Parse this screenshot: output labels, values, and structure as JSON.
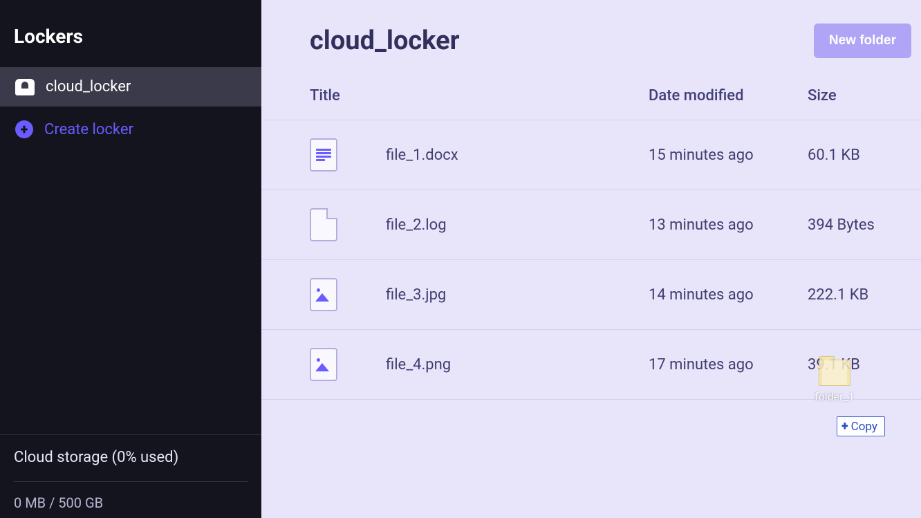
{
  "sidebar": {
    "title": "Lockers",
    "locker_name": "cloud_locker",
    "create_label": "Create locker",
    "storage_label": "Cloud storage (0% used)",
    "storage_amount": "0 MB / 500 GB"
  },
  "main": {
    "title": "cloud_locker",
    "new_folder_label": "New folder",
    "columns": {
      "title": "Title",
      "date": "Date modified",
      "size": "Size"
    },
    "rows": [
      {
        "name": "file_1.docx",
        "date": "15 minutes ago",
        "size": "60.1 KB",
        "kind": "doc"
      },
      {
        "name": "file_2.log",
        "date": "13 minutes ago",
        "size": "394 Bytes",
        "kind": "file"
      },
      {
        "name": "file_3.jpg",
        "date": "14 minutes ago",
        "size": "222.1 KB",
        "kind": "image"
      },
      {
        "name": "file_4.png",
        "date": "17 minutes ago",
        "size": "39.1 KB",
        "kind": "image"
      }
    ]
  },
  "drag": {
    "folder_label": "folder_1",
    "copy_label": "Copy"
  }
}
